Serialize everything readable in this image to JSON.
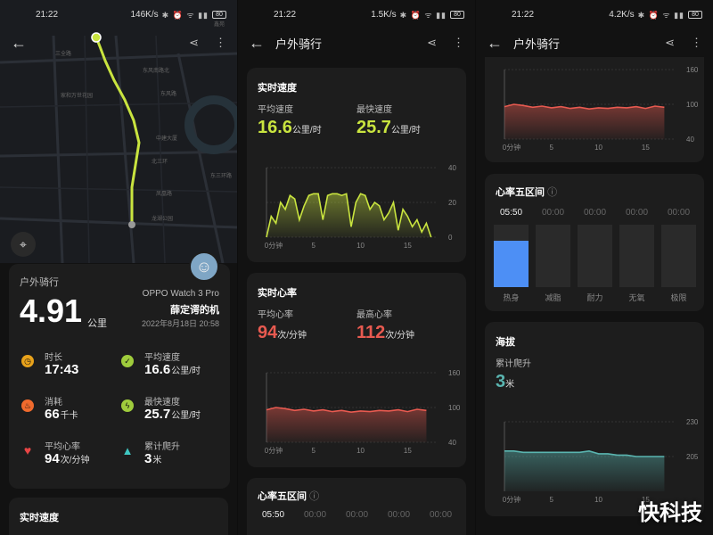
{
  "colors": {
    "speed": "#c9e43f",
    "heart": "#e85a50",
    "altitude": "#5ab5b0",
    "zone": "#4d8ff5"
  },
  "status_bars": [
    {
      "time": "21:22",
      "speed": "146K/s",
      "battery": "80"
    },
    {
      "time": "21:22",
      "speed": "1.5K/s",
      "battery": "80"
    },
    {
      "time": "21:22",
      "speed": "4.2K/s",
      "battery": "80"
    }
  ],
  "page_title": "户外骑行",
  "map": {
    "labels": [
      "三全路",
      "东风南路北",
      "家和万世花园",
      "东风路",
      "中建大厦",
      "北三环",
      "东三环路",
      "凤凰路",
      "龙湖公园",
      "鑫苑"
    ]
  },
  "summary": {
    "type": "户外骑行",
    "distance": "4.91",
    "distance_unit": "公里",
    "device": "OPPO Watch 3 Pro",
    "owner": "薛定谔的机",
    "datetime": "2022年8月18日 20:58",
    "metrics": [
      {
        "label": "时长",
        "value": "17:43",
        "unit": "",
        "icon": "stopwatch-icon",
        "color": "#e8a21b"
      },
      {
        "label": "平均速度",
        "value": "16.6",
        "unit": "公里/时",
        "icon": "speed-icon",
        "color": "#9fcc3c"
      },
      {
        "label": "消耗",
        "value": "66",
        "unit": "千卡",
        "icon": "flame-icon",
        "color": "#f06a2d"
      },
      {
        "label": "最快速度",
        "value": "25.7",
        "unit": "公里/时",
        "icon": "lightning-icon",
        "color": "#9fcc3c"
      },
      {
        "label": "平均心率",
        "value": "94",
        "unit": "次/分钟",
        "icon": "heart-icon",
        "color": "#e84545"
      },
      {
        "label": "累计爬升",
        "value": "3",
        "unit": "米",
        "icon": "triangle-icon",
        "color": "#3fc7c1"
      }
    ],
    "next_card_title": "实时速度"
  },
  "speed": {
    "title": "实时速度",
    "avg_label": "平均速度",
    "avg_value": "16.6",
    "avg_unit": "公里/时",
    "max_label": "最快速度",
    "max_value": "25.7",
    "max_unit": "公里/时"
  },
  "heart": {
    "title": "实时心率",
    "avg_label": "平均心率",
    "avg_value": "94",
    "avg_unit": "次/分钟",
    "max_label": "最高心率",
    "max_value": "112",
    "max_unit": "次/分钟"
  },
  "zones": {
    "title": "心率五区间",
    "items": [
      {
        "time": "05:50",
        "label": "热身",
        "fraction": 0.75
      },
      {
        "time": "00:00",
        "label": "减脂",
        "fraction": 0
      },
      {
        "time": "00:00",
        "label": "耐力",
        "fraction": 0
      },
      {
        "time": "00:00",
        "label": "无氧",
        "fraction": 0
      },
      {
        "time": "00:00",
        "label": "极限",
        "fraction": 0
      }
    ]
  },
  "altitude": {
    "title": "海拔",
    "label": "累计爬升",
    "value": "3",
    "unit": "米"
  },
  "watermark": "快科技",
  "chart_data": [
    {
      "type": "area",
      "title": "实时速度",
      "x_tick_labels": [
        "0分钟",
        "5",
        "10",
        "15"
      ],
      "ylim": [
        0,
        40
      ],
      "y_ticks": [
        0,
        20,
        40
      ],
      "x": [
        0,
        0.5,
        1,
        1.5,
        2,
        2.5,
        3,
        3.5,
        4,
        4.5,
        5,
        5.5,
        6,
        6.5,
        7,
        7.5,
        8,
        8.5,
        9,
        9.5,
        10,
        10.5,
        11,
        11.5,
        12,
        12.5,
        13,
        13.5,
        14,
        14.5,
        15,
        15.5,
        16,
        16.5,
        17,
        17.5
      ],
      "values": [
        0,
        12,
        8,
        20,
        16,
        24,
        22,
        10,
        18,
        24,
        25,
        25,
        10,
        24,
        25,
        25,
        24,
        25,
        6,
        20,
        25,
        24,
        16,
        20,
        18,
        10,
        14,
        20,
        4,
        16,
        12,
        6,
        10,
        3,
        8,
        0
      ]
    },
    {
      "type": "area",
      "title": "实时心率",
      "x_tick_labels": [
        "0分钟",
        "5",
        "10",
        "15"
      ],
      "ylim": [
        40,
        160
      ],
      "y_ticks": [
        40,
        100,
        160
      ],
      "x": [
        0,
        1,
        2,
        3,
        4,
        5,
        6,
        7,
        8,
        9,
        10,
        11,
        12,
        13,
        14,
        15,
        16,
        17
      ],
      "values": [
        96,
        100,
        98,
        95,
        97,
        94,
        96,
        93,
        95,
        92,
        94,
        93,
        95,
        94,
        96,
        93,
        97,
        95
      ]
    },
    {
      "type": "area",
      "title": "海拔",
      "x_tick_labels": [
        "0分钟",
        "5",
        "10",
        "15"
      ],
      "ylim": [
        180,
        230
      ],
      "y_ticks": [
        205,
        230
      ],
      "x": [
        0,
        1,
        2,
        3,
        4,
        5,
        6,
        7,
        8,
        9,
        10,
        11,
        12,
        13,
        14,
        15,
        16,
        17
      ],
      "values": [
        209,
        209,
        208,
        208,
        208,
        208,
        208,
        208,
        208,
        209,
        207,
        207,
        206,
        206,
        205,
        205,
        205,
        205
      ]
    }
  ]
}
